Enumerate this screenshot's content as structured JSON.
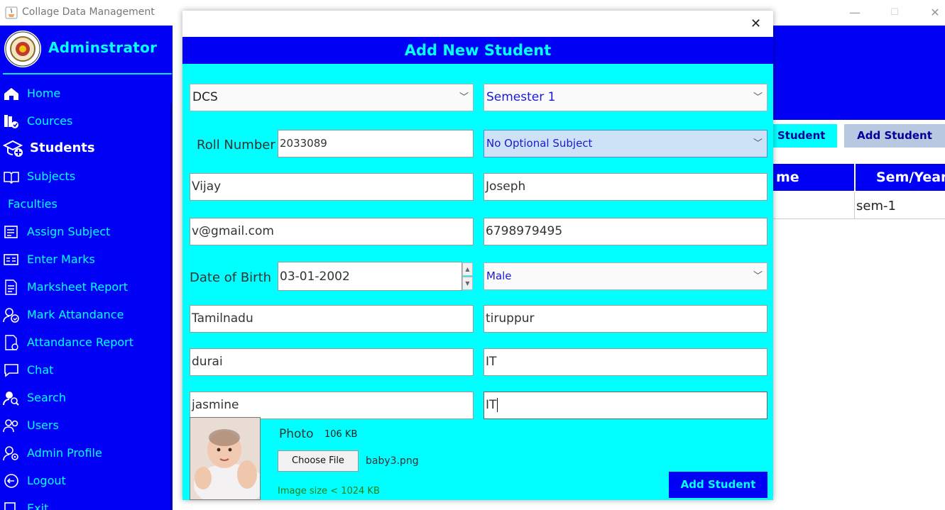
{
  "window": {
    "title": "Collage Data Management",
    "min": "—",
    "max": "☐",
    "close": "✕"
  },
  "sidebar": {
    "brand": "Adminstrator",
    "items": [
      {
        "label": "Home",
        "icon": "home-icon"
      },
      {
        "label": "Cources",
        "icon": "books-icon"
      },
      {
        "label": "Students",
        "icon": "graduation-cap-icon"
      },
      {
        "label": "Subjects",
        "icon": "open-book-icon"
      },
      {
        "label": "Faculties",
        "icon": ""
      },
      {
        "label": "Assign Subject",
        "icon": "assign-icon"
      },
      {
        "label": "Enter Marks",
        "icon": "marks-icon"
      },
      {
        "label": "Marksheet Report",
        "icon": "report-icon"
      },
      {
        "label": "Mark Attandance",
        "icon": "attendance-icon"
      },
      {
        "label": "Attandance Report",
        "icon": "attendance-report-icon"
      },
      {
        "label": "Chat",
        "icon": "chat-icon"
      },
      {
        "label": "Search",
        "icon": "search-user-icon"
      },
      {
        "label": "Users",
        "icon": "users-icon"
      },
      {
        "label": "Admin Profile",
        "icon": "admin-profile-icon"
      },
      {
        "label": "Logout",
        "icon": "logout-icon"
      },
      {
        "label": "Exit",
        "icon": "exit-icon"
      }
    ]
  },
  "background": {
    "tab_student": "Student",
    "tab_add_student": "Add Student",
    "table_headers": [
      "me",
      "Sem/Year"
    ],
    "row1_sem": "sem-1"
  },
  "dialog": {
    "close": "✕",
    "heading": "Add New Student",
    "department": "DCS",
    "semester": "Semester 1",
    "roll_label": "Roll Number",
    "roll_value": "2033089",
    "optional_subject": "No Optional Subject",
    "first_name": "Vijay",
    "last_name": "Joseph",
    "email": "v@gmail.com",
    "phone": "6798979495",
    "dob_label": "Date of Birth",
    "dob_value": "03-01-2002",
    "gender": "Male",
    "state": "Tamilnadu",
    "city": "tiruppur",
    "father_name": "durai",
    "father_occupation": "IT",
    "mother_name": "jasmine",
    "mother_occupation": "IT",
    "photo_label": "Photo",
    "photo_size": "106 KB",
    "choose_file": "Choose File",
    "file_name": "baby3.png",
    "size_hint": "Image size < 1024 KB",
    "submit": "Add Student"
  },
  "colors": {
    "sidebar": "#0000f5",
    "accent": "#00ffff",
    "hint": "#2e7d0e"
  }
}
